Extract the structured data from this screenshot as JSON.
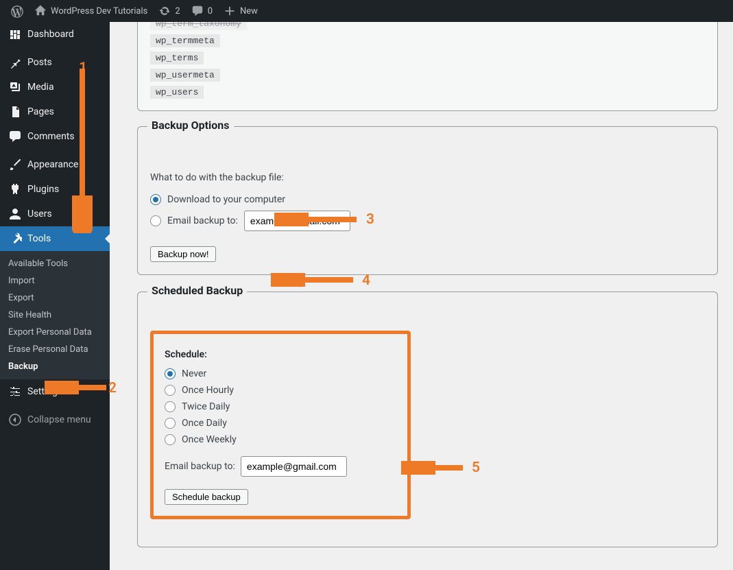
{
  "adminbar": {
    "site_title": "WordPress Dev Tutorials",
    "update_count": "2",
    "comment_count": "0",
    "new_label": "New"
  },
  "sidebar": {
    "dashboard": "Dashboard",
    "posts": "Posts",
    "media": "Media",
    "pages": "Pages",
    "comments": "Comments",
    "appearance": "Appearance",
    "plugins": "Plugins",
    "users": "Users",
    "tools": "Tools",
    "settings": "Settings",
    "collapse": "Collapse menu",
    "tools_sub": {
      "available": "Available Tools",
      "import": "Import",
      "export": "Export",
      "site_health": "Site Health",
      "export_personal": "Export Personal Data",
      "erase_personal": "Erase Personal Data",
      "backup": "Backup"
    }
  },
  "tables": {
    "wp_term_taxonomy": "wp_term_taxonomy",
    "wp_termmeta": "wp_termmeta",
    "wp_terms": "wp_terms",
    "wp_usermeta": "wp_usermeta",
    "wp_users": "wp_users"
  },
  "backup_options": {
    "legend": "Backup Options",
    "what_label": "What to do with the backup file:",
    "download_label": "Download to your computer",
    "email_label": "Email backup to:",
    "email_value": "example@gmail.com",
    "button": "Backup now!"
  },
  "scheduled": {
    "legend": "Scheduled Backup",
    "schedule_label": "Schedule:",
    "never": "Never",
    "hourly": "Once Hourly",
    "twice": "Twice Daily",
    "daily": "Once Daily",
    "weekly": "Once Weekly",
    "email_label": "Email backup to:",
    "email_value": "example@gmail.com",
    "button": "Schedule backup"
  },
  "annotations": {
    "n1": "1",
    "n2": "2",
    "n3": "3",
    "n4": "4",
    "n5": "5"
  }
}
